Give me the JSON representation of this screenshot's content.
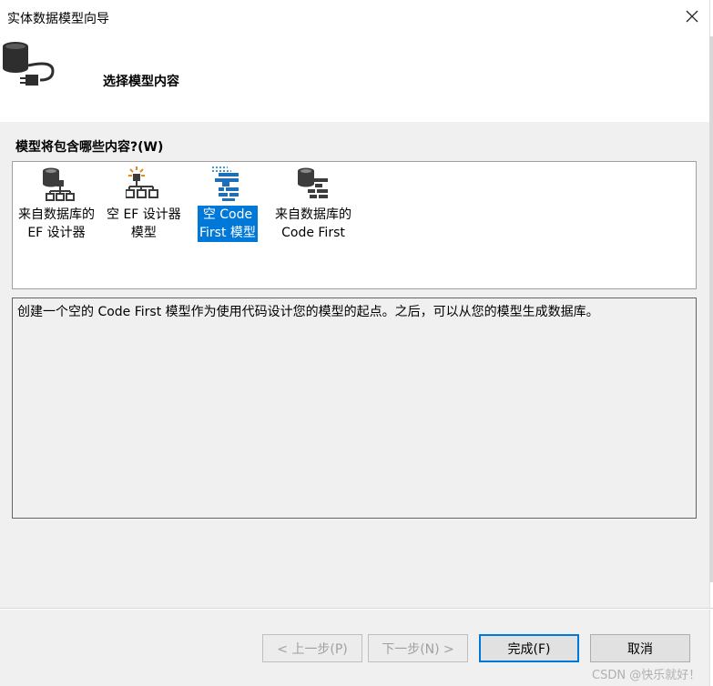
{
  "window": {
    "title": "实体数据模型向导"
  },
  "header": {
    "title": "选择模型内容"
  },
  "question": {
    "label": "模型将包含哪些内容?(W)"
  },
  "options": [
    {
      "label_line1": "来自数据库的",
      "label_line2": "EF 设计器",
      "icon": "database-designer-icon",
      "selected": false
    },
    {
      "label_line1": "空 EF 设计器",
      "label_line2": "模型",
      "icon": "empty-designer-icon",
      "selected": false
    },
    {
      "label_line1": "空 Code",
      "label_line2": "First 模型",
      "icon": "empty-code-first-icon",
      "selected": true
    },
    {
      "label_line1": "来自数据库的",
      "label_line2": "Code First",
      "icon": "database-code-first-icon",
      "selected": false
    }
  ],
  "description": {
    "text": "创建一个空的 Code First 模型作为使用代码设计您的模型的起点。之后，可以从您的模型生成数据库。"
  },
  "buttons": {
    "prev": "< 上一步(P)",
    "next": "下一步(N) >",
    "finish": "完成(F)",
    "cancel": "取消"
  },
  "watermark": "CSDN @快乐就好！",
  "colors": {
    "selection": "#0078d7",
    "window": "#f0f0f0",
    "icon_dark": "#3c3c3c",
    "icon_blue": "#1e6fb8"
  }
}
